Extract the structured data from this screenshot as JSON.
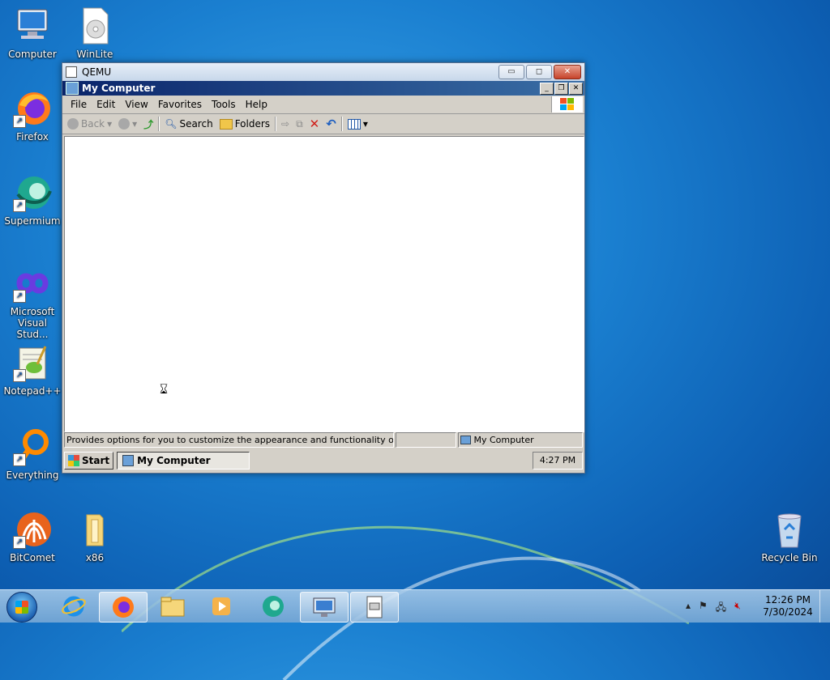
{
  "desktop_icons": [
    {
      "label": "Computer",
      "icon": "computer-icon"
    },
    {
      "label": "WinLite",
      "icon": "disc-file-icon"
    },
    {
      "label": "Firefox",
      "icon": "firefox-icon"
    },
    {
      "label": "Supermium",
      "icon": "supermium-icon"
    },
    {
      "label": "Microsoft Visual Stud...",
      "icon": "visual-studio-icon"
    },
    {
      "label": "Notepad++",
      "icon": "notepadpp-icon"
    },
    {
      "label": "Everything",
      "icon": "everything-search-icon"
    },
    {
      "label": "BitComet",
      "icon": "bitcomet-icon"
    },
    {
      "label": "x86",
      "icon": "folder-icon"
    },
    {
      "label": "Recycle Bin",
      "icon": "recycle-bin-icon"
    }
  ],
  "qemu": {
    "title": "QEMU",
    "controls": {
      "minimize": "▭",
      "restore": "◻",
      "close": "✕"
    }
  },
  "xp_window": {
    "title": "My Computer",
    "menu": [
      "File",
      "Edit",
      "View",
      "Favorites",
      "Tools",
      "Help"
    ],
    "toolbar": {
      "back": "Back",
      "search": "Search",
      "folders": "Folders"
    },
    "status_text": "Provides options for you to customize the appearance and functionality of your comp",
    "status_location": "My Computer"
  },
  "xp_taskbar": {
    "start_label": "Start",
    "task_label": "My Computer",
    "clock": "4:27 PM"
  },
  "win7_taskbar": {
    "time": "12:26 PM",
    "date": "7/30/2024"
  }
}
